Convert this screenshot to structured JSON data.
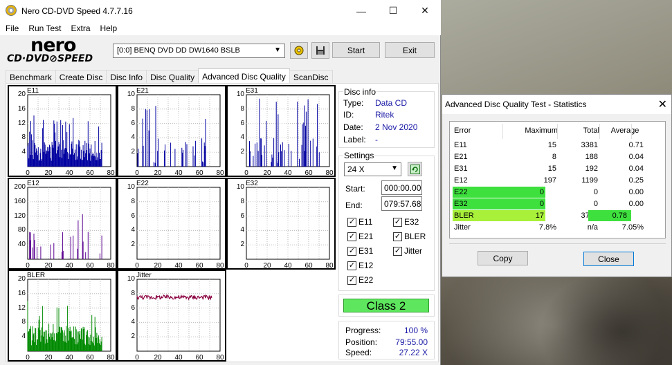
{
  "window": {
    "title": "Nero CD-DVD Speed 4.7.7.16",
    "min": "—",
    "max": "☐",
    "close": "✕"
  },
  "menu": [
    "File",
    "Run Test",
    "Extra",
    "Help"
  ],
  "logo": {
    "line1": "nero",
    "line2": "CD·DVD⊘SPEED"
  },
  "drive": {
    "value": "[0:0]   BENQ DVD DD DW1640 BSLB"
  },
  "buttons": {
    "start": "Start",
    "exit": "Exit"
  },
  "tabs": [
    "Benchmark",
    "Create Disc",
    "Disc Info",
    "Disc Quality",
    "Advanced Disc Quality",
    "ScanDisc"
  ],
  "active_tab": 4,
  "graphs": [
    {
      "name": "E11",
      "yticks": [
        "20",
        "16",
        "12",
        "8",
        "4"
      ],
      "xticks": [
        "0",
        "20",
        "40",
        "60",
        "80"
      ],
      "color": "#0000a0"
    },
    {
      "name": "E21",
      "yticks": [
        "10",
        "8",
        "6",
        "4",
        "2"
      ],
      "xticks": [
        "0",
        "20",
        "40",
        "60",
        "80"
      ],
      "color": "#0000a0"
    },
    {
      "name": "E31",
      "yticks": [
        "10",
        "8",
        "6",
        "4",
        "2"
      ],
      "xticks": [
        "0",
        "20",
        "40",
        "60",
        "80"
      ],
      "color": "#0000a0"
    },
    {
      "name": "E12",
      "yticks": [
        "200",
        "160",
        "120",
        "80",
        "40"
      ],
      "xticks": [
        "0",
        "20",
        "40",
        "60",
        "80"
      ],
      "color": "#5a0090"
    },
    {
      "name": "E22",
      "yticks": [
        "10",
        "8",
        "6",
        "4",
        "2"
      ],
      "xticks": [
        "0",
        "20",
        "40",
        "60",
        "80"
      ],
      "color": "#0000a0"
    },
    {
      "name": "E32",
      "yticks": [
        "10",
        "8",
        "6",
        "4",
        "2"
      ],
      "xticks": [
        "0",
        "20",
        "40",
        "60",
        "80"
      ],
      "color": "#0000a0"
    },
    {
      "name": "BLER",
      "yticks": [
        "20",
        "16",
        "12",
        "8",
        "4"
      ],
      "xticks": [
        "0",
        "20",
        "40",
        "60",
        "80"
      ],
      "color": "#008a00"
    },
    {
      "name": "Jitter",
      "yticks": [
        "10",
        "8",
        "6",
        "4",
        "2"
      ],
      "xticks": [
        "0",
        "20",
        "40",
        "60",
        "80"
      ],
      "color": "#8a0040"
    }
  ],
  "disc_info": {
    "title": "Disc info",
    "type_label": "Type:",
    "type": "Data CD",
    "id_label": "ID:",
    "id": "Ritek",
    "date_label": "Date:",
    "date": "2 Nov 2020",
    "label_label": "Label:",
    "label": "-"
  },
  "settings": {
    "title": "Settings",
    "speed": "24 X",
    "start_label": "Start:",
    "start": "000:00.00",
    "end_label": "End:",
    "end": "079:57.68",
    "checks": [
      "E11",
      "E32",
      "E21",
      "BLER",
      "E31",
      "Jitter",
      "E12",
      "E22"
    ]
  },
  "class_label": "Class 2",
  "progress": {
    "progress_label": "Progress:",
    "progress": "100 %",
    "position_label": "Position:",
    "position": "79:55.00",
    "speed_label": "Speed:",
    "speed": "27.22 X"
  },
  "stats": {
    "title": "Advanced Disc Quality Test - Statistics",
    "headers": [
      "Error",
      "Maximum",
      "Total",
      "Average"
    ],
    "rows": [
      [
        "E11",
        "15",
        "3381",
        "0.71"
      ],
      [
        "E21",
        "8",
        "188",
        "0.04"
      ],
      [
        "E31",
        "15",
        "192",
        "0.04"
      ],
      [
        "E12",
        "197",
        "1199",
        "0.25"
      ],
      [
        "E22",
        "0",
        "0",
        "0.00"
      ],
      [
        "E32",
        "0",
        "0",
        "0.00"
      ],
      [
        "BLER",
        "17",
        "3761",
        "0.78"
      ],
      [
        "Jitter",
        "7.8%",
        "n/a",
        "7.05%"
      ]
    ],
    "copy": "Copy",
    "close": "Close"
  },
  "colors": {
    "highlight": "#3ee03e",
    "highlight_bler": "#a8f03a",
    "class_green": "#5ee75e",
    "value_blue": "#1a1aa6"
  }
}
